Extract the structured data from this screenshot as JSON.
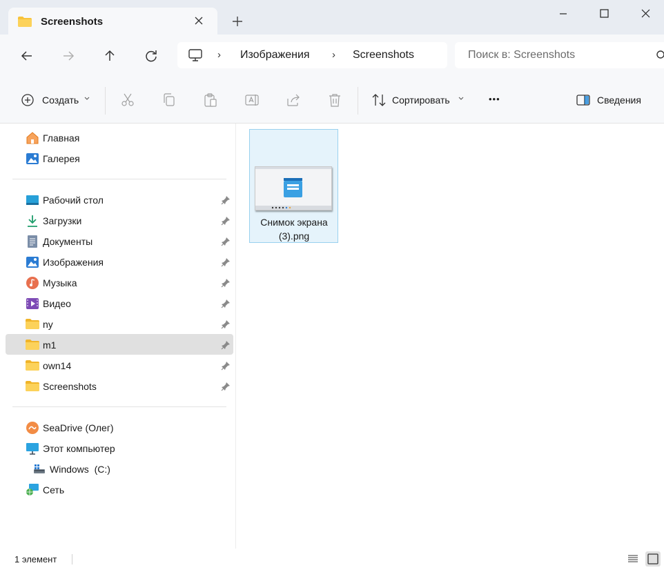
{
  "window": {
    "tab_title": "Screenshots",
    "tab_close_icon": "close-icon",
    "new_tab_symbol": "+",
    "minimize_symbol": "—",
    "maximize_symbol": "☐",
    "close_symbol": "✕"
  },
  "address": {
    "breadcrumb": [
      "Изображения",
      "Screenshots"
    ],
    "separator": "›",
    "search_placeholder": "Поиск в: Screenshots"
  },
  "toolbar": {
    "create_label": "Создать",
    "sort_label": "Сортировать",
    "more_label": "•••",
    "details_label": "Сведения"
  },
  "sidebar": {
    "quick": [
      {
        "label": "Главная",
        "icon": "home-icon"
      },
      {
        "label": "Галерея",
        "icon": "gallery-icon"
      }
    ],
    "pinned": [
      {
        "label": "Рабочий стол",
        "icon": "desktop-icon"
      },
      {
        "label": "Загрузки",
        "icon": "download-icon"
      },
      {
        "label": "Документы",
        "icon": "documents-icon"
      },
      {
        "label": "Изображения",
        "icon": "pictures-icon"
      },
      {
        "label": "Музыка",
        "icon": "music-icon"
      },
      {
        "label": "Видео",
        "icon": "video-icon"
      },
      {
        "label": "ny",
        "icon": "folder-icon"
      },
      {
        "label": "m1",
        "icon": "folder-icon",
        "selected": true
      },
      {
        "label": "own14",
        "icon": "folder-icon"
      },
      {
        "label": "Screenshots",
        "icon": "folder-icon"
      }
    ],
    "drives": [
      {
        "label": "SeaDrive (Олег)",
        "icon": "seadrive-icon"
      },
      {
        "label": "Этот компьютер",
        "icon": "computer-icon"
      },
      {
        "label": "Windows  (C:)",
        "icon": "drive-icon"
      },
      {
        "label": "Сеть",
        "icon": "network-icon"
      }
    ]
  },
  "content": {
    "files": [
      {
        "name": "Снимок экрана (3).png",
        "name_line1": "Снимок экрана",
        "name_line2": "(3).png",
        "selected": true
      }
    ]
  },
  "status": {
    "item_count": "1 элемент"
  },
  "colors": {
    "accent": "#0078d4",
    "folder": "#f8c33b",
    "selection_bg": "#e5f3fb",
    "selection_border": "#99d1ef"
  }
}
